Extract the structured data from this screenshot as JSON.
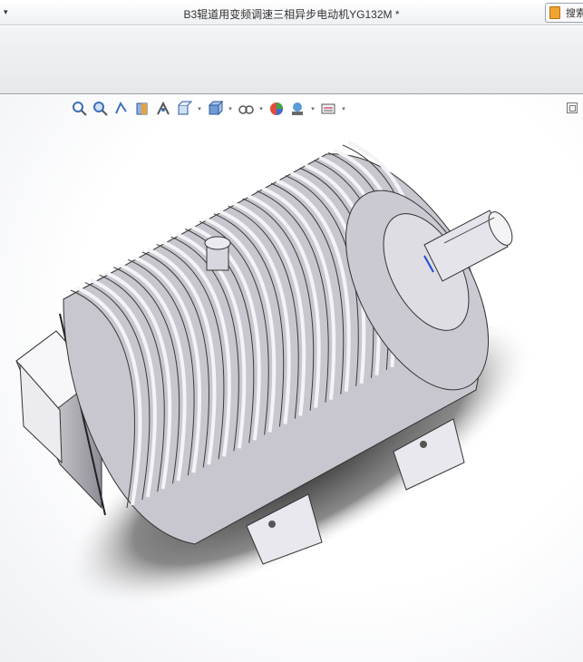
{
  "window": {
    "title": "B3辊道用变频调速三相异步电动机YG132M *",
    "menu_arrow": "▾"
  },
  "search": {
    "label": "搜索"
  },
  "viewport": {
    "toolbar": [
      {
        "name": "zoom-to-fit-icon"
      },
      {
        "name": "zoom-to-area-icon"
      },
      {
        "name": "previous-view-icon"
      },
      {
        "name": "section-view-icon"
      },
      {
        "name": "dynamic-annotation-icon"
      },
      {
        "name": "view-orientation-icon",
        "dropdown": true
      },
      {
        "name": "display-style-icon",
        "dropdown": true
      },
      {
        "name": "hide-show-items-icon",
        "dropdown": true
      },
      {
        "name": "edit-appearance-icon"
      },
      {
        "name": "apply-scene-icon",
        "dropdown": true
      },
      {
        "name": "view-settings-icon",
        "dropdown": true
      }
    ]
  }
}
